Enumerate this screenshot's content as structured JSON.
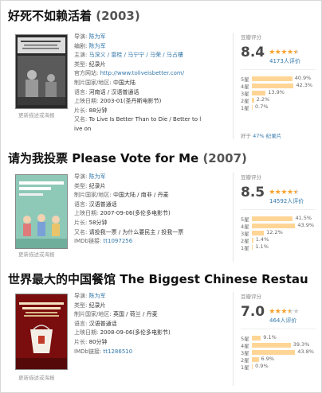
{
  "movies": [
    {
      "title": "好死不如赖活着",
      "title_en": "",
      "year": "(2003)",
      "poster_link": "更新描述或海报",
      "info": [
        {
          "label": "导演: ",
          "value": "陈为军",
          "link": true
        },
        {
          "label": "编剧: ",
          "value": "陈为军",
          "link": true
        },
        {
          "label": "主演: ",
          "value": "马深义 / 雷桂 / 马宁宁 / 马荣 / 马占樓",
          "link": true
        },
        {
          "label": "类型: ",
          "value": "纪录片",
          "link": false
        },
        {
          "label": "官方网站: ",
          "value": "http://www.toliveisbetter.com/",
          "link": true
        },
        {
          "label": "制片国家/地区: ",
          "value": "中国大陆",
          "link": false
        },
        {
          "label": "语言: ",
          "value": "河南话 / 汉语普通话",
          "link": false
        },
        {
          "label": "上映日期: ",
          "value": "2003-01(圣丹斯电影节)",
          "link": false
        },
        {
          "label": "片长: ",
          "value": "88分钟",
          "link": false
        },
        {
          "label": "又名: ",
          "value": "To Live Is Better Than to Die / Better to l",
          "link": false
        },
        {
          "label": "",
          "value": "ive on",
          "link": false
        }
      ],
      "rating_label": "豆瓣评分",
      "score": "8.4",
      "stars": 4.5,
      "count": "4173人评价",
      "distribution": [
        {
          "star": "5星",
          "pct": "40.9%",
          "value": 40.9
        },
        {
          "star": "4星",
          "pct": "42.3%",
          "value": 42.3
        },
        {
          "star": "3星",
          "pct": "13.9%",
          "value": 13.9
        },
        {
          "star": "2星",
          "pct": "2.2%",
          "value": 2.2
        },
        {
          "star": "1星",
          "pct": "0.7%",
          "value": 0.7
        }
      ],
      "better_than": {
        "prefix": "好于 ",
        "pct": "47%",
        "genre": "纪录片"
      }
    },
    {
      "title": "请为我投票",
      "title_en": "Please Vote for Me",
      "year": "(2007)",
      "poster_link": "更新描述或海报",
      "info": [
        {
          "label": "导演: ",
          "value": "陈为军",
          "link": true
        },
        {
          "label": "类型: ",
          "value": "纪录片",
          "link": false
        },
        {
          "label": "制片国家/地区: ",
          "value": "中国大陆 / 南非 / 丹麦",
          "link": false
        },
        {
          "label": "语言: ",
          "value": "汉语普通话",
          "link": false
        },
        {
          "label": "上映日期: ",
          "value": "2007-09-06(多伦多电影节)",
          "link": false
        },
        {
          "label": "片长: ",
          "value": "58分钟",
          "link": false
        },
        {
          "label": "又名: ",
          "value": "请投我一票 / 为什么要民主 / 投我一票",
          "link": false
        },
        {
          "label": "IMDb链接: ",
          "value": "tt1097256",
          "link": true
        }
      ],
      "rating_label": "豆瓣评分",
      "score": "8.5",
      "stars": 4.5,
      "count": "14592人评价",
      "distribution": [
        {
          "star": "5星",
          "pct": "41.5%",
          "value": 41.5
        },
        {
          "star": "4星",
          "pct": "43.9%",
          "value": 43.9
        },
        {
          "star": "3星",
          "pct": "12.2%",
          "value": 12.2
        },
        {
          "star": "2星",
          "pct": "1.4%",
          "value": 1.4
        },
        {
          "star": "1星",
          "pct": "1.1%",
          "value": 1.1
        }
      ]
    },
    {
      "title": "世界最大的中国餐馆",
      "title_en": "The Biggest Chinese Restau",
      "year": "",
      "poster_link": "更新描述或海报",
      "info": [
        {
          "label": "导演: ",
          "value": "陈为军",
          "link": true
        },
        {
          "label": "类型: ",
          "value": "纪录片",
          "link": false
        },
        {
          "label": "制片国家/地区: ",
          "value": "英国 / 荷兰 / 丹麦",
          "link": false
        },
        {
          "label": "语言: ",
          "value": "汉语普通话",
          "link": false
        },
        {
          "label": "上映日期: ",
          "value": "2008-09-06(多伦多电影节)",
          "link": false
        },
        {
          "label": "片长: ",
          "value": "80分钟",
          "link": false
        },
        {
          "label": "IMDb链接: ",
          "value": "tt1286510",
          "link": true
        }
      ],
      "rating_label": "豆瓣评分",
      "score": "7.0",
      "stars": 3.5,
      "count": "464人评价",
      "distribution": [
        {
          "star": "5星",
          "pct": "9.1%",
          "value": 9.1
        },
        {
          "star": "4星",
          "pct": "39.3%",
          "value": 39.3
        },
        {
          "star": "3星",
          "pct": "43.8%",
          "value": 43.8
        },
        {
          "star": "2星",
          "pct": "6.9%",
          "value": 6.9
        },
        {
          "star": "1星",
          "pct": "0.9%",
          "value": 0.9
        }
      ]
    }
  ],
  "colors": {
    "link": "#3377aa",
    "star": "#f7a22b",
    "bar": "#ffd596"
  }
}
